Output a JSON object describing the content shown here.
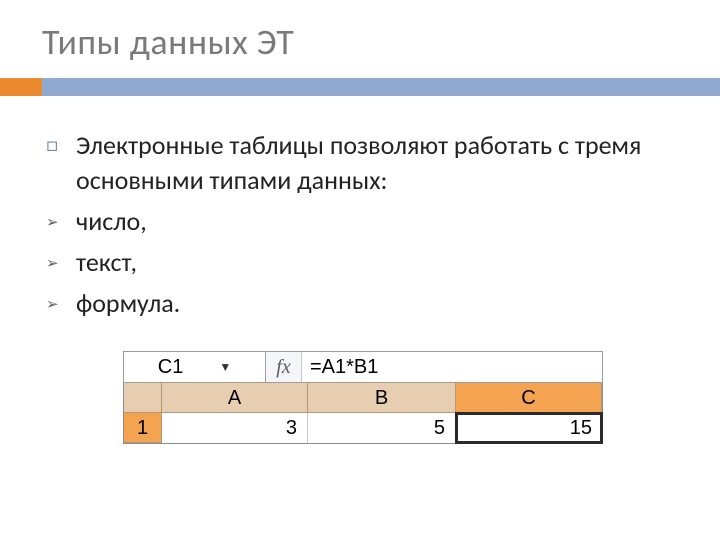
{
  "title": "Типы данных ЭТ",
  "intro": "Электронные таблицы позволяют работать с тремя основными типами данных:",
  "items": [
    "число,",
    "текст,",
    "формула."
  ],
  "sheet": {
    "name_box": "C1",
    "fx_label": "fx",
    "formula": "=A1*B1",
    "cols": [
      "A",
      "B",
      "C"
    ],
    "row_label": "1",
    "cells": {
      "A1": "3",
      "B1": "5",
      "C1": "15"
    }
  }
}
